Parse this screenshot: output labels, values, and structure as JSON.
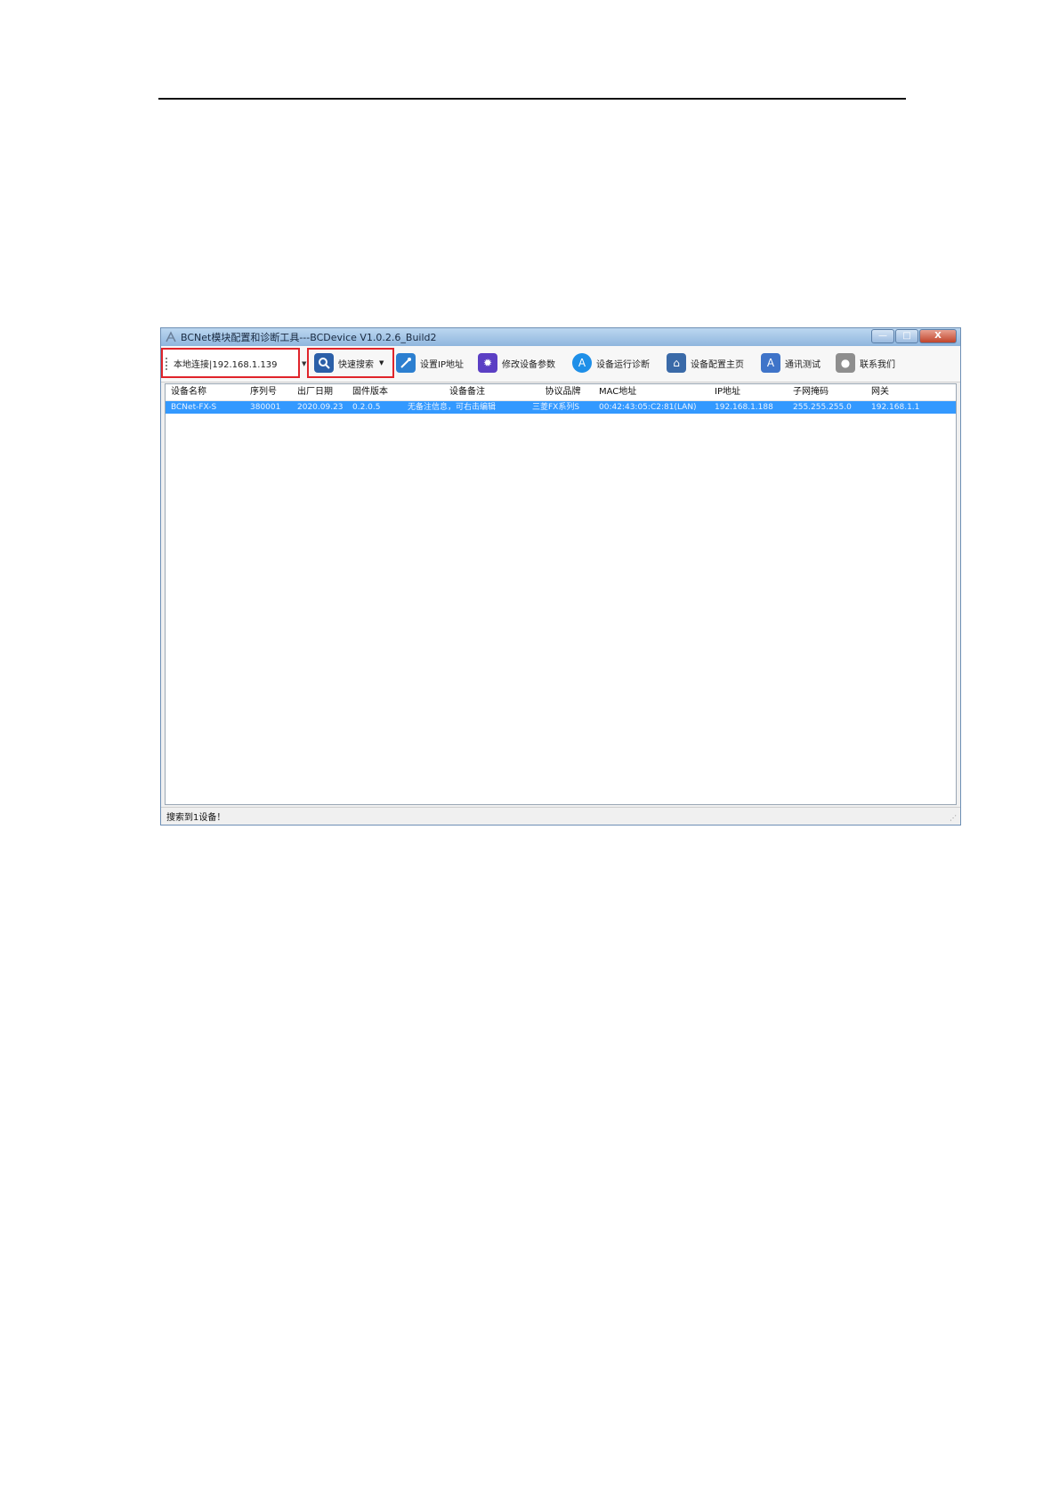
{
  "window": {
    "title": "BCNet模块配置和诊断工具---BCDevice V1.0.2.6_Build2",
    "controls": {
      "minimize": "—",
      "maximize": "□",
      "close": "X"
    }
  },
  "toolbar": {
    "connection": "本地连接|192.168.1.139",
    "search_label": "快速搜索",
    "items": [
      {
        "label": "设置IP地址",
        "icon": "wrench-icon",
        "color": "#2c7fd0"
      },
      {
        "label": "修改设备参数",
        "icon": "gear-icon",
        "color": "#5b3fc4"
      },
      {
        "label": "设备运行诊断",
        "icon": "appstore-icon",
        "color": "#1e8fe8"
      },
      {
        "label": "设备配置主页",
        "icon": "home-icon",
        "color": "#3a6aa8"
      },
      {
        "label": "通讯测试",
        "icon": "appstore-icon",
        "color": "#3f74c9"
      },
      {
        "label": "联系我们",
        "icon": "contact-icon",
        "color": "#8e8e8e"
      }
    ]
  },
  "table": {
    "columns": [
      "设备名称",
      "序列号",
      "出厂日期",
      "固件版本",
      "设备备注",
      "协议品牌",
      "MAC地址",
      "IP地址",
      "子网掩码",
      "网关"
    ],
    "rows": [
      [
        "BCNet-FX-S",
        "380001",
        "2020.09.23",
        "0.2.0.5",
        "无备注信息，可右击编辑",
        "三菱FX系列S",
        "00:42:43:05:C2:81(LAN)",
        "192.168.1.188",
        "255.255.255.0",
        "192.168.1.1"
      ]
    ]
  },
  "status": {
    "text": "搜索到1设备！"
  }
}
